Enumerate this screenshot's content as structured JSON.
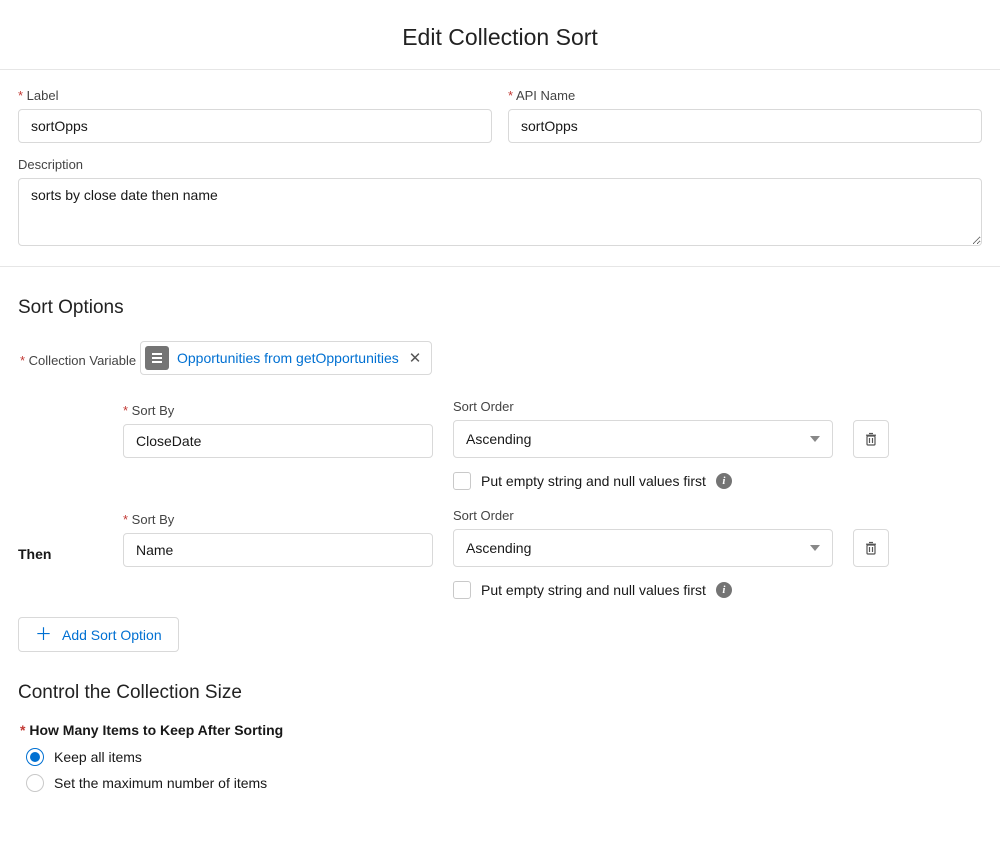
{
  "header": {
    "title": "Edit Collection Sort"
  },
  "fields": {
    "label_label": "Label",
    "label_value": "sortOpps",
    "api_label": "API Name",
    "api_value": "sortOpps",
    "desc_label": "Description",
    "desc_value": "sorts by close date then name"
  },
  "sort": {
    "section_title": "Sort Options",
    "collection_label": "Collection Variable",
    "collection_value": "Opportunities from getOpportunities",
    "then_label": "Then",
    "sortby_label": "Sort By",
    "order_label": "Sort Order",
    "null_first_label": "Put empty string and null values first",
    "items": [
      {
        "sort_by": "CloseDate",
        "order": "Ascending"
      },
      {
        "sort_by": "Name",
        "order": "Ascending"
      }
    ],
    "add_label": "Add Sort Option"
  },
  "control": {
    "section_title": "Control the Collection Size",
    "keep_label": "How Many Items to Keep After Sorting",
    "options": {
      "keep_all": "Keep all items",
      "set_max": "Set the maximum number of items"
    },
    "selected": "keep_all"
  }
}
